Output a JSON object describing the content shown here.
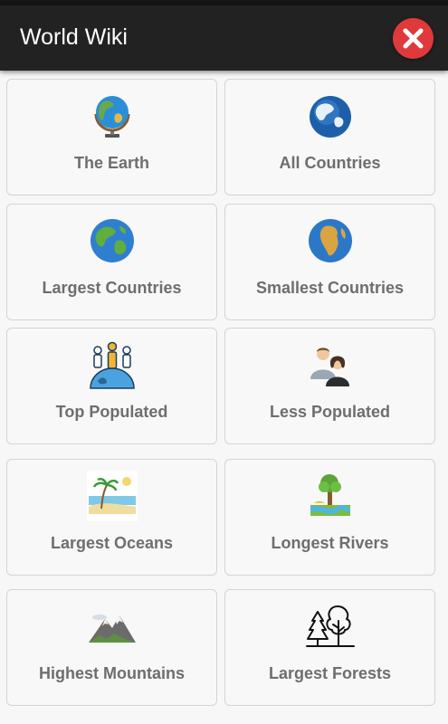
{
  "app": {
    "title": "World Wiki"
  },
  "colors": {
    "appbar": "#222222",
    "close": "#e0393c",
    "label": "#6e6e6e",
    "card_border": "#d4d4d4"
  },
  "icons": {
    "close": "close-x-icon"
  },
  "cards": [
    {
      "label": "The Earth",
      "icon": "desk-globe-icon"
    },
    {
      "label": "All Countries",
      "icon": "blue-globe-icon"
    },
    {
      "label": "Largest Countries",
      "icon": "earth-globe-icon"
    },
    {
      "label": "Smallest Countries",
      "icon": "globe-africa-icon"
    },
    {
      "label": "Top Populated",
      "icon": "people-on-globe-icon"
    },
    {
      "label": "Less Populated",
      "icon": "two-people-icon"
    },
    {
      "label": "Largest Oceans",
      "icon": "beach-ocean-icon"
    },
    {
      "label": "Longest Rivers",
      "icon": "river-tree-icon"
    },
    {
      "label": "Highest Mountains",
      "icon": "mountain-icon"
    },
    {
      "label": "Largest Forests",
      "icon": "forest-trees-icon"
    }
  ]
}
